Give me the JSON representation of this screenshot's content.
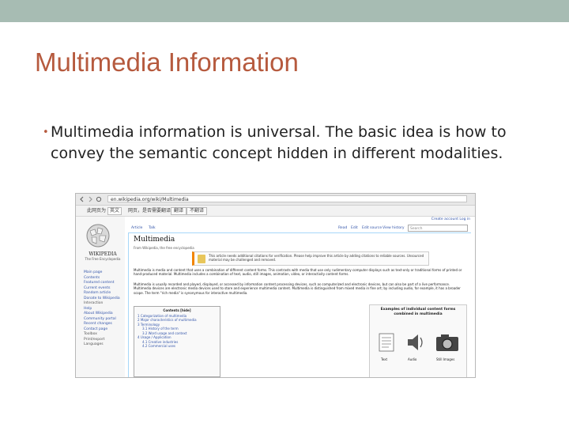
{
  "slide": {
    "title": "Multimedia Information",
    "bullet_marker": "•",
    "bullet": "Multimedia information is universal. The basic idea is how to convey the semantic concept hidden in different modalities.",
    "accent_color": "#b65a3e",
    "topbar_color": "#a7bcb3"
  },
  "browser": {
    "url": "en.wikipedia.org/wiki/Multimedia",
    "toolbar_items": [
      "此网页为",
      "英文",
      "网页，是否需要翻译？",
      "翻译",
      "不翻译"
    ],
    "wiki": {
      "logo_text": "WIKIPEDIA",
      "logo_sub": "The Free Encyclopedia",
      "sidebar_links": [
        "Main page",
        "Contents",
        "Featured content",
        "Current events",
        "Random article",
        "Donate to Wikipedia",
        "Interaction",
        "Help",
        "About Wikipedia",
        "Community portal",
        "Recent changes",
        "Contact page",
        "Toolbox",
        "Print/export",
        "Languages"
      ],
      "tabs": [
        "Article",
        "Talk",
        "Read",
        "Edit",
        "Edit source",
        "View history"
      ],
      "search_placeholder": "Search",
      "personal": "Create account  Log in",
      "article_title": "Multimedia",
      "from": "From Wikipedia, the free encyclopedia",
      "ambox": "This article needs additional citations for verification. Please help improve this article by adding citations to reliable sources. Unsourced material may be challenged and removed.",
      "para1": "Multimedia is media and content that uses a combination of different content forms. This contrasts with media that use only rudimentary computer displays such as text-only or traditional forms of printed or hand-produced material. Multimedia includes a combination of text, audio, still images, animation, video, or interactivity content forms.",
      "para2": "Multimedia is usually recorded and played, displayed, or accessed by information content processing devices, such as computerized and electronic devices, but can also be part of a live performance. Multimedia devices are electronic media devices used to store and experience multimedia content. Multimedia is distinguished from mixed media in fine art; by including audio, for example, it has a broader scope. The term \"rich media\" is synonymous for interactive multimedia.",
      "toc_title": "Contents [hide]",
      "toc_items": [
        "1 Categorization of multimedia",
        "2 Major characteristics of multimedia",
        "3 Terminology",
        "3.1 History of the term",
        "3.2 Word usage and context",
        "4 Usage / Application",
        "4.1 Creative industries",
        "4.2 Commercial uses"
      ],
      "thumb_caption": "Examples of individual content forms combined in multimedia",
      "thumb_labels": [
        "Text",
        "Audio",
        "Still Images"
      ]
    }
  }
}
